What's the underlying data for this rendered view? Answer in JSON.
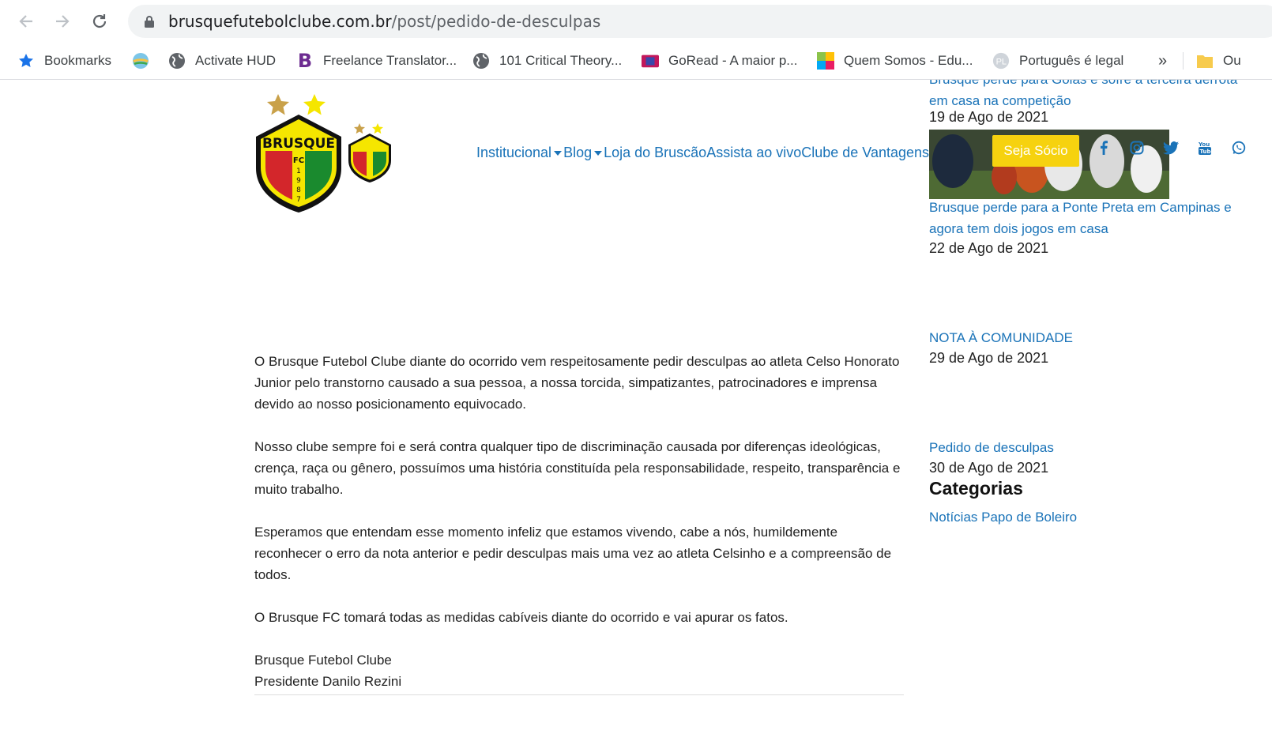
{
  "browser": {
    "url_domain": "brusquefutebolclube.com.br",
    "url_path": "/post/pedido-de-desculpas",
    "bookmarks": [
      {
        "label": "Bookmarks",
        "icon": "star-icon"
      },
      {
        "label": "",
        "icon": "globe-colored-icon"
      },
      {
        "label": "Activate HUD",
        "icon": "globe-icon"
      },
      {
        "label": "Freelance Translator...",
        "icon": "b-logo-icon"
      },
      {
        "label": "101 Critical Theory...",
        "icon": "globe-icon"
      },
      {
        "label": "GoRead - A maior p...",
        "icon": "goread-icon"
      },
      {
        "label": "Quem Somos - Edu...",
        "icon": "puzzle-icon"
      },
      {
        "label": "Português é legal",
        "icon": "pl-icon"
      },
      {
        "label": "»",
        "icon": "chevron-more"
      },
      {
        "label": "Ou",
        "icon": "folder-icon"
      }
    ]
  },
  "header": {
    "logo_text": "BRUSQUE",
    "logo_sub": "FC",
    "logo_year": "1987",
    "nav": [
      {
        "label": "Institucional",
        "dropdown": true
      },
      {
        "label": "Blog",
        "dropdown": true
      },
      {
        "label": "Loja do Bruscão",
        "dropdown": false
      },
      {
        "label": "Assista ao vivo",
        "dropdown": false
      },
      {
        "label": "Clube de Vantagens",
        "dropdown": false
      }
    ],
    "cta": "Seja Sócio",
    "social": [
      "facebook-icon",
      "instagram-icon",
      "twitter-icon",
      "youtube-icon",
      "whatsapp-icon"
    ]
  },
  "sidebar": {
    "posts": [
      {
        "title": "Brusque perde para Goiás e sofre a terceira derrota em casa na competição",
        "date": "19 de Ago de 2021"
      },
      {
        "title": "Brusque perde para a Ponte Preta em Campinas e agora tem dois jogos em casa",
        "date": "22 de Ago de 2021"
      },
      {
        "title": "NOTA À COMUNIDADE",
        "date": "29 de Ago de 2021"
      },
      {
        "title": "Pedido de desculpas",
        "date": "30 de Ago de 2021"
      }
    ],
    "categories_title": "Categorias",
    "categories": [
      "Notícias Papo de Boleiro"
    ]
  },
  "article": {
    "paragraphs": [
      "O Brusque Futebol Clube diante do ocorrido vem respeitosamente pedir desculpas ao atleta Celso Honorato Junior pelo transtorno causado a sua pessoa, a nossa torcida, simpatizantes, patrocinadores e imprensa devido ao nosso posicionamento equivocado.",
      "Nosso clube sempre foi e será contra qualquer tipo de discriminação causada por diferenças ideológicas, crença, raça ou gênero, possuímos uma história constituída pela responsabilidade, respeito, transparência e muito trabalho.",
      "Esperamos que entendam esse momento infeliz que estamos vivendo, cabe a nós, humildemente reconhecer o erro da nota anterior e pedir desculpas mais uma vez ao atleta Celsinho e a compreensão de todos.",
      "O Brusque FC tomará todas as medidas cabíveis diante do ocorrido e vai apurar os fatos."
    ],
    "signature_line1": "Brusque Futebol Clube",
    "signature_line2": "Presidente Danilo Rezini"
  },
  "colors": {
    "link": "#1a73b8",
    "cta": "#f6d20f",
    "shield_yellow": "#f5e600",
    "shield_green": "#1a8a2e",
    "shield_red": "#d3262b"
  }
}
